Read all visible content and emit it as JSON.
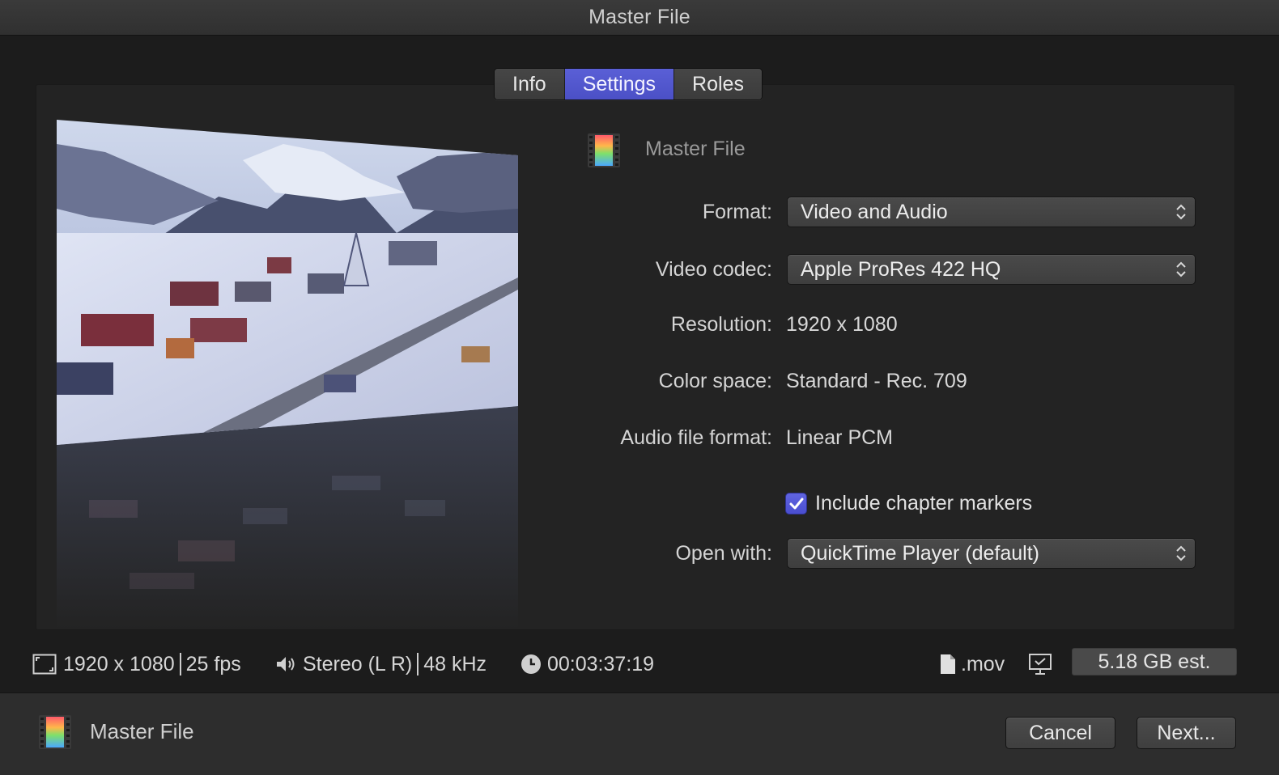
{
  "window": {
    "title": "Master File"
  },
  "tabs": [
    {
      "label": "Info",
      "active": false
    },
    {
      "label": "Settings",
      "active": true
    },
    {
      "label": "Roles",
      "active": false
    }
  ],
  "preview": {
    "icon": "film-strip-icon"
  },
  "header": {
    "title": "Master File",
    "icon": "film-strip-icon"
  },
  "form": {
    "format_label": "Format:",
    "format_value": "Video and Audio",
    "codec_label": "Video codec:",
    "codec_value": "Apple ProRes 422 HQ",
    "resolution_label": "Resolution:",
    "resolution_value": "1920 x 1080",
    "colorspace_label": "Color space:",
    "colorspace_value": "Standard - Rec. 709",
    "audio_label": "Audio file format:",
    "audio_value": "Linear PCM",
    "chapter_label": "Include chapter markers",
    "chapter_checked": true,
    "openwith_label": "Open with:",
    "openwith_value": "QuickTime Player (default)"
  },
  "status": {
    "resolution": "1920 x 1080",
    "fps": "25 fps",
    "audio": "Stereo (L R)",
    "sample_rate": "48 kHz",
    "duration": "00:03:37:19",
    "extension": ".mov",
    "size": "5.18 GB est."
  },
  "footer": {
    "title": "Master File",
    "cancel": "Cancel",
    "next": "Next..."
  },
  "colors": {
    "accent": "#5358d3",
    "background": "#1c1c1c"
  }
}
